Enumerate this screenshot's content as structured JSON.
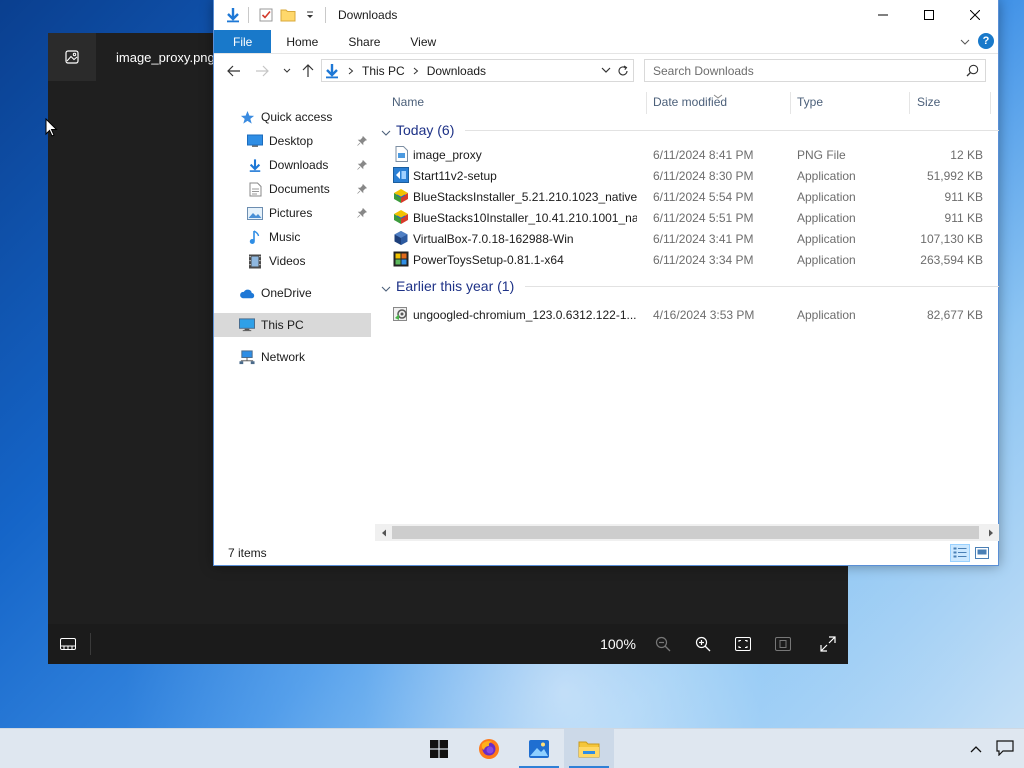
{
  "photos": {
    "title": "image_proxy.png",
    "zoom": "100%"
  },
  "explorer": {
    "title": "Downloads",
    "ribbon_tabs": [
      {
        "label": "File"
      },
      {
        "label": "Home"
      },
      {
        "label": "Share"
      },
      {
        "label": "View"
      }
    ],
    "breadcrumb": [
      "This PC",
      "Downloads"
    ],
    "search_placeholder": "Search Downloads",
    "nav": {
      "quick_access": "Quick access",
      "desktop": "Desktop",
      "downloads": "Downloads",
      "documents": "Documents",
      "pictures": "Pictures",
      "music": "Music",
      "videos": "Videos",
      "onedrive": "OneDrive",
      "this_pc": "This PC",
      "network": "Network"
    },
    "columns": {
      "name": "Name",
      "date": "Date modified",
      "type": "Type",
      "size": "Size"
    },
    "groups": [
      {
        "label": "Today (6)",
        "files": [
          {
            "name": "image_proxy",
            "date": "6/11/2024 8:41 PM",
            "type": "PNG File",
            "size": "12 KB",
            "icon": "png-file-icon"
          },
          {
            "name": "Start11v2-setup",
            "date": "6/11/2024 8:30 PM",
            "type": "Application",
            "size": "51,992 KB",
            "icon": "installer-icon"
          },
          {
            "name": "BlueStacksInstaller_5.21.210.1023_native_...",
            "date": "6/11/2024 5:54 PM",
            "type": "Application",
            "size": "911 KB",
            "icon": "bluestacks-icon"
          },
          {
            "name": "BlueStacks10Installer_10.41.210.1001_nati...",
            "date": "6/11/2024 5:51 PM",
            "type": "Application",
            "size": "911 KB",
            "icon": "bluestacks-icon"
          },
          {
            "name": "VirtualBox-7.0.18-162988-Win",
            "date": "6/11/2024 3:41 PM",
            "type": "Application",
            "size": "107,130 KB",
            "icon": "virtualbox-icon"
          },
          {
            "name": "PowerToysSetup-0.81.1-x64",
            "date": "6/11/2024 3:34 PM",
            "type": "Application",
            "size": "263,594 KB",
            "icon": "powertoys-icon"
          }
        ]
      },
      {
        "label": "Earlier this year (1)",
        "files": [
          {
            "name": "ungoogled-chromium_123.0.6312.122-1....",
            "date": "4/16/2024 3:53 PM",
            "type": "Application",
            "size": "82,677 KB",
            "icon": "setup-icon"
          }
        ]
      }
    ],
    "status": "7 items"
  },
  "colors": {
    "accent": "#1979ca",
    "group_header": "#1e3287",
    "photos_bg": "#1f1f1f"
  }
}
